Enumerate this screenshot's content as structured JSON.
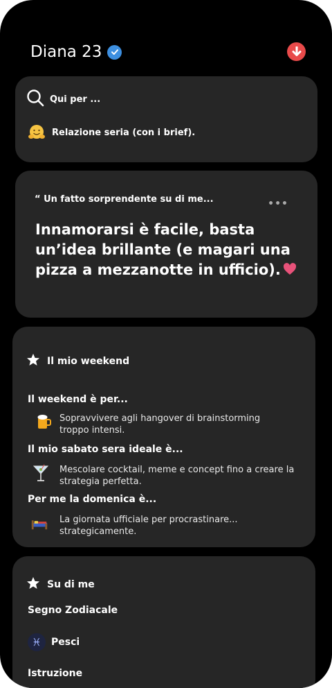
{
  "profile": {
    "name": "Diana 23"
  },
  "looking_for": {
    "title": "Qui per ...",
    "value": "Relazione seria (con i brief)."
  },
  "prompt": {
    "question": "“ Un fatto sorprendente su di me...",
    "answer": "Innamorarsi è facile, basta un’idea brillante (e magari una pizza a mezzanotte in ufficio).",
    "more": "•••"
  },
  "weekend": {
    "title": "Il mio weekend",
    "items": [
      {
        "question": "Il weekend è per...",
        "answer": "Sopravvivere agli hangover di brainstorming troppo intensi."
      },
      {
        "question": "Il mio sabato sera ideale è...",
        "answer": "Mescolare cocktail, meme e concept fino a creare la strategia perfetta."
      },
      {
        "question": "Per me la domenica è...",
        "answer": "La giornata ufficiale per procrastinare... strategicamente."
      }
    ]
  },
  "about": {
    "title": "Su di me",
    "zodiac_label": "Segno Zodiacale",
    "zodiac_value": "Pesci",
    "zodiac_symbol": "♓",
    "education_label": "Istruzione"
  },
  "colors": {
    "card": "#262626",
    "background": "#000000",
    "accent_red": "#e84a4a",
    "verified_blue": "#3d8fe0",
    "heart": "#e8527a"
  }
}
